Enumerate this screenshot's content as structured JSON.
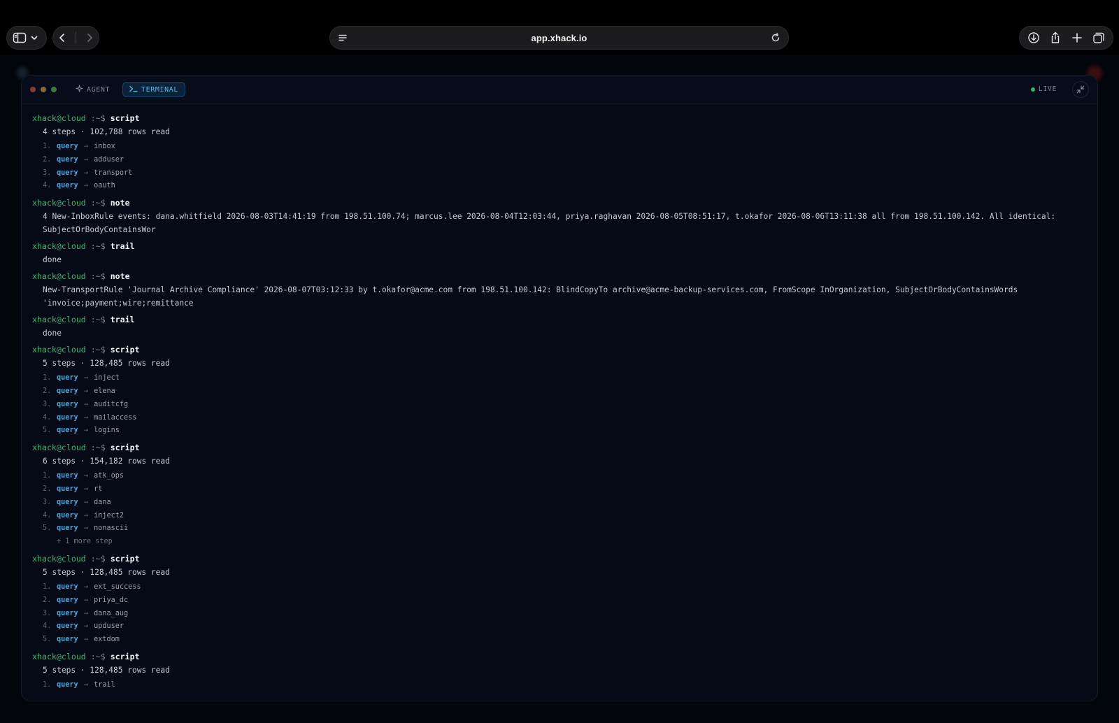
{
  "browser": {
    "url": "app.xhack.io"
  },
  "terminal": {
    "tabs": [
      {
        "label": "AGENT"
      },
      {
        "label": "TERMINAL"
      }
    ],
    "live_label": "LIVE",
    "prompt": {
      "user": "xhack@cloud",
      "path": ":~$"
    },
    "step_keyword": "query",
    "blocks": [
      {
        "command": "script",
        "output": [
          "4 steps · 102,788 rows read"
        ],
        "steps": [
          {
            "n": "1.",
            "target": "inbox"
          },
          {
            "n": "2.",
            "target": "adduser"
          },
          {
            "n": "3.",
            "target": "transport"
          },
          {
            "n": "4.",
            "target": "oauth"
          }
        ]
      },
      {
        "command": "note",
        "output": [
          "4 New-InboxRule events: dana.whitfield 2026-08-03T14:41:19 from 198.51.100.74; marcus.lee 2026-08-04T12:03:44, priya.raghavan 2026-08-05T08:51:17, t.okafor 2026-08-06T13:11:38 all from 198.51.100.142. All identical: SubjectOrBodyContainsWor"
        ]
      },
      {
        "command": "trail",
        "output": [
          "done"
        ]
      },
      {
        "command": "note",
        "output": [
          "New-TransportRule 'Journal Archive Compliance' 2026-08-07T03:12:33 by t.okafor@acme.com from 198.51.100.142: BlindCopyTo archive@acme-backup-services.com, FromScope InOrganization, SubjectOrBodyContainsWords 'invoice;payment;wire;remittance"
        ]
      },
      {
        "command": "trail",
        "output": [
          "done"
        ]
      },
      {
        "command": "script",
        "output": [
          "5 steps · 128,485 rows read"
        ],
        "steps": [
          {
            "n": "1.",
            "target": "inject"
          },
          {
            "n": "2.",
            "target": "elena"
          },
          {
            "n": "3.",
            "target": "auditcfg"
          },
          {
            "n": "4.",
            "target": "mailaccess"
          },
          {
            "n": "5.",
            "target": "logins"
          }
        ]
      },
      {
        "command": "script",
        "output": [
          "6 steps · 154,182 rows read"
        ],
        "steps": [
          {
            "n": "1.",
            "target": "atk_ops"
          },
          {
            "n": "2.",
            "target": "rt"
          },
          {
            "n": "3.",
            "target": "dana"
          },
          {
            "n": "4.",
            "target": "inject2"
          },
          {
            "n": "5.",
            "target": "nonascii"
          }
        ],
        "more": "+ 1 more step"
      },
      {
        "command": "script",
        "output": [
          "5 steps · 128,485 rows read"
        ],
        "steps": [
          {
            "n": "1.",
            "target": "ext_success"
          },
          {
            "n": "2.",
            "target": "priya_dc"
          },
          {
            "n": "3.",
            "target": "dana_aug"
          },
          {
            "n": "4.",
            "target": "upduser"
          },
          {
            "n": "5.",
            "target": "extdom"
          }
        ]
      },
      {
        "command": "script",
        "output": [
          "5 steps · 128,485 rows read"
        ],
        "steps": [
          {
            "n": "1.",
            "target": "trail"
          }
        ]
      }
    ]
  },
  "colors": {
    "prompt_user": "#3fb672",
    "query_keyword": "#4ba6df",
    "live_indicator": "#2fb86a",
    "terminal_tab_active": "#66b4e4"
  }
}
